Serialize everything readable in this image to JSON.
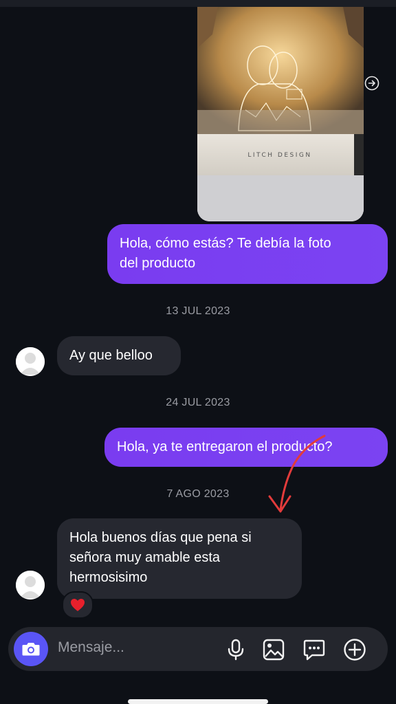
{
  "messages": {
    "outgoing_1": [
      "Hola, cómo estás? Te debía la foto",
      "del producto"
    ],
    "date_1": "13 JUL 2023",
    "incoming_1": "Ay que belloo",
    "date_2": "24 JUL 2023",
    "outgoing_2": "Hola, ya te entregaron el producto?",
    "date_3": "7 AGO 2023",
    "incoming_2": [
      "Hola buenos días que pena si",
      "señora muy amable esta",
      "hermosisimo"
    ]
  },
  "photo": {
    "box_brand": "LITCH DESIGN"
  },
  "reaction": {
    "emoji": "❤️"
  },
  "composer": {
    "placeholder": "Mensaje..."
  },
  "icons": [
    "share-icon",
    "camera-icon",
    "microphone-icon",
    "gallery-icon",
    "sticker-icon",
    "plus-icon"
  ],
  "colors": {
    "background": "#0d1016",
    "outgoing_bubble": "#7a3cf0",
    "incoming_bubble": "#262830",
    "camera_button": "#5a55f5",
    "annotation_arrow": "#e23b3b"
  }
}
